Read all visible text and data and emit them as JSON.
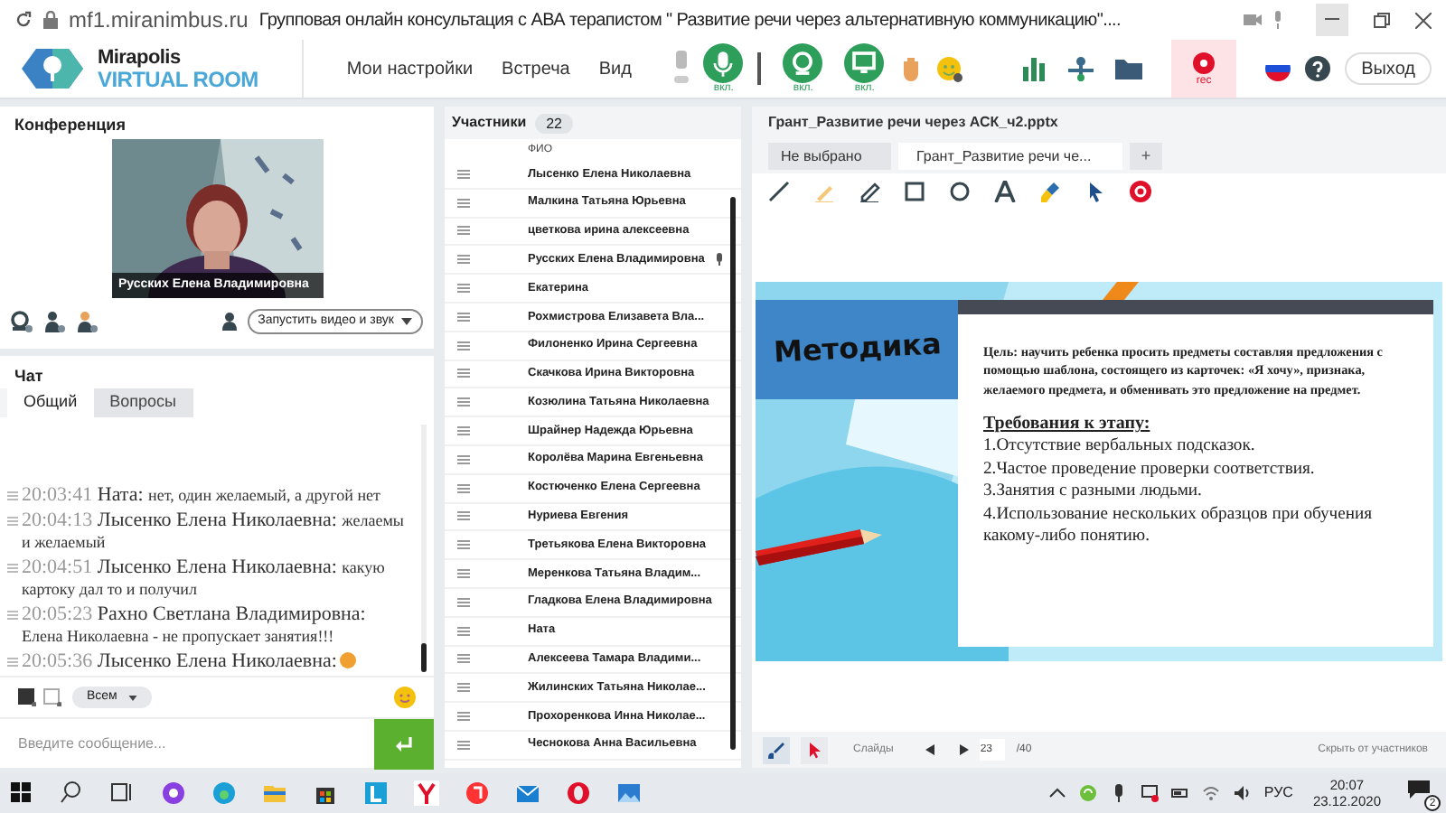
{
  "browser": {
    "address": "mf1.miranimbus.ru",
    "title": "Групповая онлайн консультация с АВА терапистом \" Развитие речи через альтернативную коммуникацию\"...."
  },
  "header": {
    "logo_top": "Mirapolis",
    "logo_bottom": "VIRTUAL ROOM",
    "menu": [
      "Мои настройки",
      "Встреча",
      "Вид"
    ],
    "devices": [
      {
        "kind": "mic",
        "label": "вкл.",
        "on": true
      },
      {
        "kind": "camera",
        "label": "вкл.",
        "on": true
      },
      {
        "kind": "screen",
        "label": "вкл.",
        "on": true
      }
    ],
    "record_label": "rec",
    "exit": "Выход"
  },
  "conference": {
    "title": "Конференция",
    "video_label": "Русских Елена Владимировна",
    "start_button": "Запустить видео и звук"
  },
  "chat": {
    "title": "Чат",
    "tabs": [
      {
        "label": "Общий",
        "selected": true
      },
      {
        "label": "Вопросы",
        "selected": false
      }
    ],
    "messages": [
      {
        "time": "20:03:41",
        "author": "Ната:",
        "text": "нет, один желаемый, а другой нет"
      },
      {
        "time": "20:04:13",
        "author": "Лысенко Елена  Николаевна:",
        "text": "желаемы и желаемый"
      },
      {
        "time": "20:04:51",
        "author": "Лысенко Елена  Николаевна:",
        "text": "какую картоку дал то и получил"
      },
      {
        "time": "20:05:23",
        "author": "Рахно Светлана  Владимировна:",
        "text": "Елена Николаевна - не пропускает занятия!!!"
      },
      {
        "time": "20:05:36",
        "author": "Лысенко Елена  Николаевна:"
      }
    ],
    "recipient": "Всем",
    "placeholder": "Введите сообщение..."
  },
  "participants": {
    "title": "Участники",
    "count": "22",
    "column": "ФИО",
    "rows": [
      {
        "name": "Лысенко Елена  Николаевна",
        "speaking": false
      },
      {
        "name": "Малкина Татьяна  Юрьевна",
        "speaking": false
      },
      {
        "name": "цветкова  ирина алексеевна",
        "speaking": false
      },
      {
        "name": "Русских Елена Владимировна",
        "speaking": true
      },
      {
        "name": "Екатерина",
        "speaking": false
      },
      {
        "name": "Рохмистрова  Елизавета Вла...",
        "speaking": false
      },
      {
        "name": "Филоненко Ирина  Сергеевна",
        "speaking": false
      },
      {
        "name": "Скачкова  Ирина Викторовна",
        "speaking": false
      },
      {
        "name": "Козюлина  Татьяна Николаевна",
        "speaking": false
      },
      {
        "name": "Шрайнер Надежда  Юрьевна",
        "speaking": false
      },
      {
        "name": "Королёва Марина Евгеньевна",
        "speaking": false
      },
      {
        "name": "Костюченко  Елена Сергеевна",
        "speaking": false
      },
      {
        "name": "Нуриева Евгения",
        "speaking": false
      },
      {
        "name": "Третьякова  Елена Викторовна",
        "speaking": false
      },
      {
        "name": "Меренкова  Татьяна  Владим...",
        "speaking": false
      },
      {
        "name": "Гладкова Елена Владимировна",
        "speaking": false
      },
      {
        "name": "Ната",
        "speaking": false
      },
      {
        "name": "Алексеева   Тамара  Владими...",
        "speaking": false
      },
      {
        "name": "Жилинских  Татьяна Николае...",
        "speaking": false
      },
      {
        "name": "Прохоренкова  Инна Николае...",
        "speaking": false
      },
      {
        "name": "Чеснокова  Анна  Васильевна",
        "speaking": false
      }
    ]
  },
  "presentation": {
    "title": "Грант_Развитие речи через АСК_ч2.pptx",
    "tabs": [
      {
        "label": "Не выбрано",
        "selected": false
      },
      {
        "label": "Грант_Развитие речи че...",
        "selected": true
      }
    ],
    "add": "+",
    "slide": {
      "heading": "Методика",
      "goal": "**Цель:** научить ребенка просить предметы составляя предложения с помощью шаблона, состоящего из карточек: «Я хочу», признака, желаемого предмета, и обменивать это предложение на предмет.",
      "requirements_title": "Требования к этапу:",
      "requirements": [
        "1.Отсутствие вербальных подсказок.",
        "2.Частое проведение проверки соответствия.",
        "3.Занятия с разными людьми.",
        "4.Использование нескольких образцов при обучения какому-либо понятию."
      ]
    },
    "slides_label": "Слайды",
    "page": "23",
    "total": "/40",
    "hide": "Скрыть от участников"
  },
  "taskbar": {
    "language": "РУС",
    "time": "20:07",
    "date": "23.12.2020",
    "notifications": "2"
  }
}
